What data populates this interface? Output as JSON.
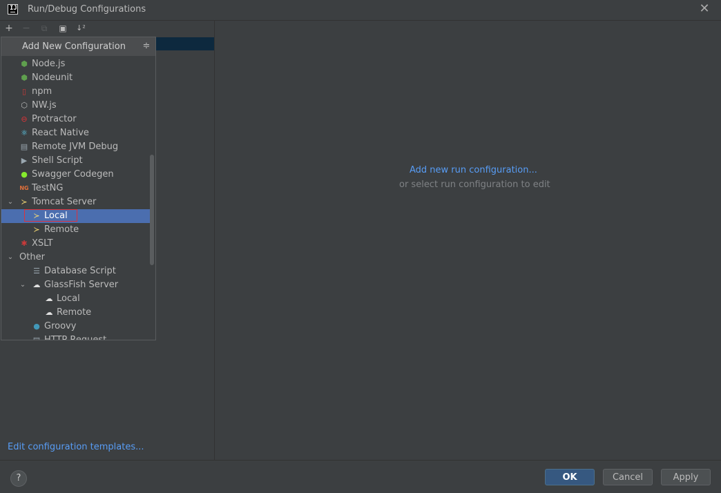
{
  "window": {
    "title": "Run/Debug Configurations",
    "app_icon_text": "IJ"
  },
  "toolbar": {
    "add_icon": "+",
    "remove_icon": "−",
    "copy_icon": "⧉",
    "folder_icon": "▣",
    "sort_icon": "↓²"
  },
  "popup": {
    "title": "Add New Configuration",
    "collapse_icon": "≑",
    "items": [
      {
        "label": "Node.js",
        "icon": "nodejs-icon",
        "glyph": "⬢",
        "color": "#5fa04e"
      },
      {
        "label": "Nodeunit",
        "icon": "nodeunit-icon",
        "glyph": "⬢",
        "color": "#5fa04e"
      },
      {
        "label": "npm",
        "icon": "npm-icon",
        "glyph": "▯",
        "color": "#cb3837"
      },
      {
        "label": "NW.js",
        "icon": "nwjs-icon",
        "glyph": "⬡",
        "color": "#bbbbbb"
      },
      {
        "label": "Protractor",
        "icon": "protractor-icon",
        "glyph": "⊖",
        "color": "#e23237"
      },
      {
        "label": "React Native",
        "icon": "react-icon",
        "glyph": "⚛",
        "color": "#61dafb"
      },
      {
        "label": "Remote JVM Debug",
        "icon": "remote-debug-icon",
        "glyph": "▤",
        "color": "#9aa7b0"
      },
      {
        "label": "Shell Script",
        "icon": "shell-script-icon",
        "glyph": "▶",
        "color": "#9aa7b0"
      },
      {
        "label": "Swagger Codegen",
        "icon": "swagger-icon",
        "glyph": "●",
        "color": "#85ea2d"
      },
      {
        "label": "TestNG",
        "icon": "testng-icon",
        "glyph": "NG",
        "color": "#e2703a"
      },
      {
        "label": "Tomcat Server",
        "icon": "tomcat-icon",
        "glyph": "≻",
        "color": "#f8dc75"
      },
      {
        "label": "Local",
        "icon": "tomcat-local-icon",
        "glyph": "≻",
        "color": "#f8dc75"
      },
      {
        "label": "Remote",
        "icon": "tomcat-remote-icon",
        "glyph": "≻",
        "color": "#f8dc75"
      },
      {
        "label": "XSLT",
        "icon": "xslt-icon",
        "glyph": "✱",
        "color": "#c93a3a"
      },
      {
        "label": "Other",
        "icon": "",
        "glyph": "",
        "color": "#bbbbbb"
      },
      {
        "label": "Database Script",
        "icon": "database-script-icon",
        "glyph": "☰",
        "color": "#9aa7b0"
      },
      {
        "label": "GlassFish Server",
        "icon": "glassfish-icon",
        "glyph": "☁",
        "color": "#e0e0e0"
      },
      {
        "label": "Local",
        "icon": "glassfish-local-icon",
        "glyph": "☁",
        "color": "#e0e0e0"
      },
      {
        "label": "Remote",
        "icon": "glassfish-remote-icon",
        "glyph": "☁",
        "color": "#e0e0e0"
      },
      {
        "label": "Groovy",
        "icon": "groovy-icon",
        "glyph": "●",
        "color": "#4298b8"
      },
      {
        "label": "HTTP Request",
        "icon": "http-request-icon",
        "glyph": "▤",
        "color": "#9aa7b0"
      }
    ]
  },
  "left_footer": {
    "edit_templates": "Edit configuration templates..."
  },
  "main": {
    "add_link": "Add new run configuration...",
    "hint": "or select run configuration to edit"
  },
  "footer": {
    "help": "?",
    "ok": "OK",
    "cancel": "Cancel",
    "apply": "Apply"
  }
}
